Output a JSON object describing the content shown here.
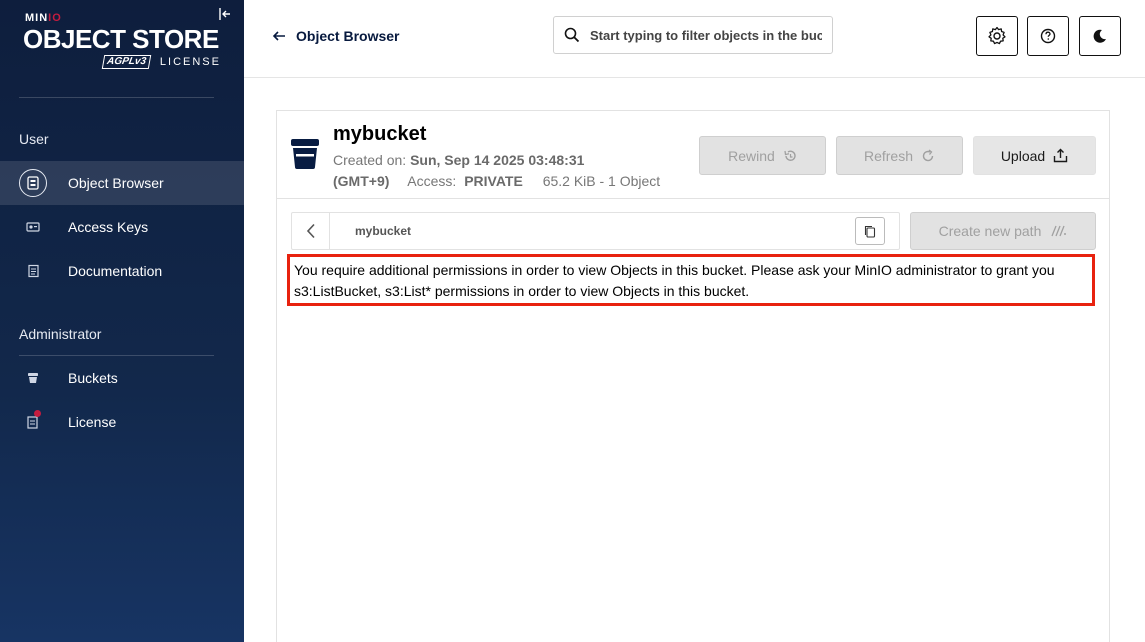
{
  "sidebar": {
    "logo": {
      "minio_prefix": "MIN",
      "minio_suffix": "IO",
      "product": "OBJECT STORE",
      "agpl": "AGPLv3",
      "license": "LICENSE"
    },
    "sections": [
      {
        "title": "User",
        "items": [
          {
            "label": "Object Browser",
            "icon": "object-browser-icon",
            "active": true
          },
          {
            "label": "Access Keys",
            "icon": "access-keys-icon"
          },
          {
            "label": "Documentation",
            "icon": "documentation-icon"
          }
        ]
      },
      {
        "title": "Administrator",
        "items": [
          {
            "label": "Buckets",
            "icon": "buckets-icon"
          },
          {
            "label": "License",
            "icon": "license-icon",
            "notification": true
          }
        ]
      }
    ]
  },
  "header": {
    "back_label": "Object Browser",
    "search_placeholder": "Start typing to filter objects in the bucket",
    "buttons": [
      "settings-icon",
      "help-icon",
      "dark-mode-icon"
    ]
  },
  "bucket": {
    "name": "mybucket",
    "created_label": "Created on:",
    "created_value": "Sun, Sep 14 2025 03:48:31",
    "timezone": "(GMT+9)",
    "access_label": "Access:",
    "access_value": "PRIVATE",
    "size_summary": "65.2 KiB - 1 Object",
    "actions": {
      "rewind": "Rewind",
      "refresh": "Refresh",
      "upload": "Upload"
    }
  },
  "browser": {
    "path": "mybucket",
    "create_path_label": "Create new path",
    "permission_message": "You require additional permissions in order to view Objects in this bucket. Please ask your MinIO administrator to grant you s3:ListBucket, s3:List* permissions in order to view Objects in this bucket."
  },
  "colors": {
    "sidebar_bg": "#0e1e3d",
    "accent_red": "#c51c3f",
    "highlight_border": "#e8220f"
  }
}
